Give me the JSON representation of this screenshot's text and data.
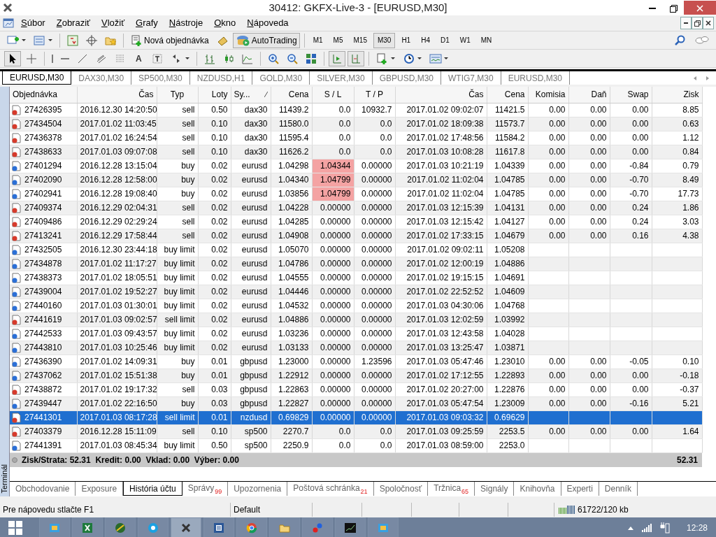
{
  "window": {
    "title": "30412: GKFX-Live-3 - [EURUSD,M30]"
  },
  "menu": [
    "Súbor",
    "Zobraziť",
    "Vložiť",
    "Grafy",
    "Nástroje",
    "Okno",
    "Nápoveda"
  ],
  "toolbar": {
    "text_tool": "A",
    "new_order": "Nová objednávka",
    "autotrading": "AutoTrading",
    "timeframes": [
      {
        "label": "M1",
        "selected": false
      },
      {
        "label": "M5",
        "selected": false
      },
      {
        "label": "M15",
        "selected": false
      },
      {
        "label": "M30",
        "selected": true
      },
      {
        "label": "H1",
        "selected": false
      },
      {
        "label": "H4",
        "selected": false
      },
      {
        "label": "D1",
        "selected": false
      },
      {
        "label": "W1",
        "selected": false
      },
      {
        "label": "MN",
        "selected": false
      }
    ]
  },
  "chart_tabs": [
    {
      "label": "EURUSD,M30",
      "selected": true
    },
    {
      "label": "DAX30,M30",
      "selected": false
    },
    {
      "label": "SP500,M30",
      "selected": false
    },
    {
      "label": "NZDUSD,H1",
      "selected": false
    },
    {
      "label": "GOLD,M30",
      "selected": false
    },
    {
      "label": "SILVER,M30",
      "selected": false
    },
    {
      "label": "GBPUSD,M30",
      "selected": false
    },
    {
      "label": "WTIG7,M30",
      "selected": false
    },
    {
      "label": "EURUSD,M30",
      "selected": false
    }
  ],
  "terminal": {
    "label": "Terminál",
    "columns": [
      "Objednávka",
      "Čas",
      "Typ",
      "Loty",
      "Sy...",
      "Cena",
      "S / L",
      "T / P",
      "Čas",
      "Cena",
      "Komisia",
      "Daň",
      "Swap",
      "Zisk"
    ],
    "rows": [
      {
        "kind": "sell",
        "sl_hit": false,
        "selected": false,
        "cells": [
          "27426395",
          "2016.12.30 14:20:50",
          "sell",
          "0.50",
          "dax30",
          "11439.2",
          "0.0",
          "10932.7",
          "2017.01.02 09:02:07",
          "11421.5",
          "0.00",
          "0.00",
          "0.00",
          "8.85"
        ]
      },
      {
        "kind": "sell",
        "sl_hit": false,
        "selected": false,
        "cells": [
          "27434504",
          "2017.01.02 11:03:45",
          "sell",
          "0.10",
          "dax30",
          "11580.0",
          "0.0",
          "0.0",
          "2017.01.02 18:09:38",
          "11573.7",
          "0.00",
          "0.00",
          "0.00",
          "0.63"
        ]
      },
      {
        "kind": "sell",
        "sl_hit": false,
        "selected": false,
        "cells": [
          "27436378",
          "2017.01.02 16:24:54",
          "sell",
          "0.10",
          "dax30",
          "11595.4",
          "0.0",
          "0.0",
          "2017.01.02 17:48:56",
          "11584.2",
          "0.00",
          "0.00",
          "0.00",
          "1.12"
        ]
      },
      {
        "kind": "sell",
        "sl_hit": false,
        "selected": false,
        "cells": [
          "27438633",
          "2017.01.03 09:07:08",
          "sell",
          "0.10",
          "dax30",
          "11626.2",
          "0.0",
          "0.0",
          "2017.01.03 10:08:28",
          "11617.8",
          "0.00",
          "0.00",
          "0.00",
          "0.84"
        ]
      },
      {
        "kind": "buy",
        "sl_hit": true,
        "selected": false,
        "cells": [
          "27401294",
          "2016.12.28 13:15:04",
          "buy",
          "0.02",
          "eurusd",
          "1.04298",
          "1.04344",
          "0.00000",
          "2017.01.03 10:21:19",
          "1.04339",
          "0.00",
          "0.00",
          "-0.84",
          "0.79"
        ]
      },
      {
        "kind": "buy",
        "sl_hit": true,
        "selected": false,
        "cells": [
          "27402090",
          "2016.12.28 12:58:00",
          "buy",
          "0.02",
          "eurusd",
          "1.04340",
          "1.04799",
          "0.00000",
          "2017.01.02 11:02:04",
          "1.04785",
          "0.00",
          "0.00",
          "-0.70",
          "8.49"
        ]
      },
      {
        "kind": "buy",
        "sl_hit": true,
        "selected": false,
        "cells": [
          "27402941",
          "2016.12.28 19:08:40",
          "buy",
          "0.02",
          "eurusd",
          "1.03856",
          "1.04799",
          "0.00000",
          "2017.01.02 11:02:04",
          "1.04785",
          "0.00",
          "0.00",
          "-0.70",
          "17.73"
        ]
      },
      {
        "kind": "sell",
        "sl_hit": false,
        "selected": false,
        "cells": [
          "27409374",
          "2016.12.29 02:04:31",
          "sell",
          "0.02",
          "eurusd",
          "1.04228",
          "0.00000",
          "0.00000",
          "2017.01.03 12:15:39",
          "1.04131",
          "0.00",
          "0.00",
          "0.24",
          "1.86"
        ]
      },
      {
        "kind": "sell",
        "sl_hit": false,
        "selected": false,
        "cells": [
          "27409486",
          "2016.12.29 02:29:24",
          "sell",
          "0.02",
          "eurusd",
          "1.04285",
          "0.00000",
          "0.00000",
          "2017.01.03 12:15:42",
          "1.04127",
          "0.00",
          "0.00",
          "0.24",
          "3.03"
        ]
      },
      {
        "kind": "sell",
        "sl_hit": false,
        "selected": false,
        "cells": [
          "27413241",
          "2016.12.29 17:58:44",
          "sell",
          "0.02",
          "eurusd",
          "1.04908",
          "0.00000",
          "0.00000",
          "2017.01.02 17:33:15",
          "1.04679",
          "0.00",
          "0.00",
          "0.16",
          "4.38"
        ]
      },
      {
        "kind": "buy",
        "sl_hit": false,
        "selected": false,
        "cells": [
          "27432505",
          "2016.12.30 23:44:18",
          "buy limit",
          "0.02",
          "eurusd",
          "1.05070",
          "0.00000",
          "0.00000",
          "2017.01.02 09:02:11",
          "1.05208"
        ]
      },
      {
        "kind": "buy",
        "sl_hit": false,
        "selected": false,
        "cells": [
          "27434878",
          "2017.01.02 11:17:27",
          "buy limit",
          "0.02",
          "eurusd",
          "1.04786",
          "0.00000",
          "0.00000",
          "2017.01.02 12:00:19",
          "1.04886"
        ]
      },
      {
        "kind": "buy",
        "sl_hit": false,
        "selected": false,
        "cells": [
          "27438373",
          "2017.01.02 18:05:51",
          "buy limit",
          "0.02",
          "eurusd",
          "1.04555",
          "0.00000",
          "0.00000",
          "2017.01.02 19:15:15",
          "1.04691"
        ]
      },
      {
        "kind": "buy",
        "sl_hit": false,
        "selected": false,
        "cells": [
          "27439004",
          "2017.01.02 19:52:27",
          "buy limit",
          "0.02",
          "eurusd",
          "1.04446",
          "0.00000",
          "0.00000",
          "2017.01.02 22:52:52",
          "1.04609"
        ]
      },
      {
        "kind": "buy",
        "sl_hit": false,
        "selected": false,
        "cells": [
          "27440160",
          "2017.01.03 01:30:01",
          "buy limit",
          "0.02",
          "eurusd",
          "1.04532",
          "0.00000",
          "0.00000",
          "2017.01.03 04:30:06",
          "1.04768"
        ]
      },
      {
        "kind": "sell",
        "sl_hit": false,
        "selected": false,
        "cells": [
          "27441619",
          "2017.01.03 09:02:57",
          "sell limit",
          "0.02",
          "eurusd",
          "1.04886",
          "0.00000",
          "0.00000",
          "2017.01.03 12:02:59",
          "1.03992"
        ]
      },
      {
        "kind": "buy",
        "sl_hit": false,
        "selected": false,
        "cells": [
          "27442533",
          "2017.01.03 09:43:57",
          "buy limit",
          "0.02",
          "eurusd",
          "1.03236",
          "0.00000",
          "0.00000",
          "2017.01.03 12:43:58",
          "1.04028"
        ]
      },
      {
        "kind": "buy",
        "sl_hit": false,
        "selected": false,
        "cells": [
          "27443810",
          "2017.01.03 10:25:46",
          "buy limit",
          "0.02",
          "eurusd",
          "1.03133",
          "0.00000",
          "0.00000",
          "2017.01.03 13:25:47",
          "1.03871"
        ]
      },
      {
        "kind": "buy",
        "sl_hit": false,
        "selected": false,
        "cells": [
          "27436390",
          "2017.01.02 14:09:31",
          "buy",
          "0.01",
          "gbpusd",
          "1.23000",
          "0.00000",
          "1.23596",
          "2017.01.03 05:47:46",
          "1.23010",
          "0.00",
          "0.00",
          "-0.05",
          "0.10"
        ]
      },
      {
        "kind": "buy",
        "sl_hit": false,
        "selected": false,
        "cells": [
          "27437062",
          "2017.01.02 15:51:38",
          "buy",
          "0.01",
          "gbpusd",
          "1.22912",
          "0.00000",
          "0.00000",
          "2017.01.02 17:12:55",
          "1.22893",
          "0.00",
          "0.00",
          "0.00",
          "-0.18"
        ]
      },
      {
        "kind": "sell",
        "sl_hit": false,
        "selected": false,
        "cells": [
          "27438872",
          "2017.01.02 19:17:32",
          "sell",
          "0.03",
          "gbpusd",
          "1.22863",
          "0.00000",
          "0.00000",
          "2017.01.02 20:27:00",
          "1.22876",
          "0.00",
          "0.00",
          "0.00",
          "-0.37"
        ]
      },
      {
        "kind": "buy",
        "sl_hit": false,
        "selected": false,
        "cells": [
          "27439447",
          "2017.01.02 22:16:50",
          "buy",
          "0.03",
          "gbpusd",
          "1.22827",
          "0.00000",
          "0.00000",
          "2017.01.03 05:47:54",
          "1.23009",
          "0.00",
          "0.00",
          "-0.16",
          "5.21"
        ]
      },
      {
        "kind": "sell",
        "sl_hit": false,
        "selected": true,
        "cells": [
          "27441301",
          "2017.01.03 08:17:28",
          "sell limit",
          "0.01",
          "nzdusd",
          "0.69829",
          "0.00000",
          "0.00000",
          "2017.01.03 09:03:32",
          "0.69629"
        ]
      },
      {
        "kind": "sell",
        "sl_hit": false,
        "selected": false,
        "cells": [
          "27403379",
          "2016.12.28 15:11:09",
          "sell",
          "0.10",
          "sp500",
          "2270.7",
          "0.0",
          "0.0",
          "2017.01.03 09:25:59",
          "2253.5",
          "0.00",
          "0.00",
          "0.00",
          "1.64"
        ]
      },
      {
        "kind": "buy",
        "sl_hit": false,
        "selected": false,
        "cells": [
          "27441391",
          "2017.01.03 08:45:34",
          "buy limit",
          "0.50",
          "sp500",
          "2250.9",
          "0.0",
          "0.0",
          "2017.01.03 08:59:00",
          "2253.0"
        ]
      }
    ],
    "summary": {
      "text": "Zisk/Strata: 52.31  Kredit: 0.00  Vklad: 0.00  Výber: 0.00",
      "total": "52.31"
    },
    "tabs": [
      {
        "label": "Obchodovanie",
        "selected": false
      },
      {
        "label": "Exposure",
        "selected": false
      },
      {
        "label": "História účtu",
        "selected": true
      },
      {
        "label": "Správy",
        "badge": "99",
        "selected": false
      },
      {
        "label": "Upozornenia",
        "selected": false
      },
      {
        "label": "Poštová schránka",
        "badge": "21",
        "selected": false
      },
      {
        "label": "Spoločnosť",
        "selected": false
      },
      {
        "label": "Tržnica",
        "badge": "65",
        "selected": false
      },
      {
        "label": "Signály",
        "selected": false
      },
      {
        "label": "Knihovňa",
        "selected": false
      },
      {
        "label": "Experti",
        "selected": false
      },
      {
        "label": "Denník",
        "selected": false
      }
    ]
  },
  "status_bar": {
    "help": "Pre nápovedu stlačte F1",
    "profile": "Default",
    "traffic": "61722/120 kb"
  },
  "taskbar": {
    "clock": "12:28"
  }
}
